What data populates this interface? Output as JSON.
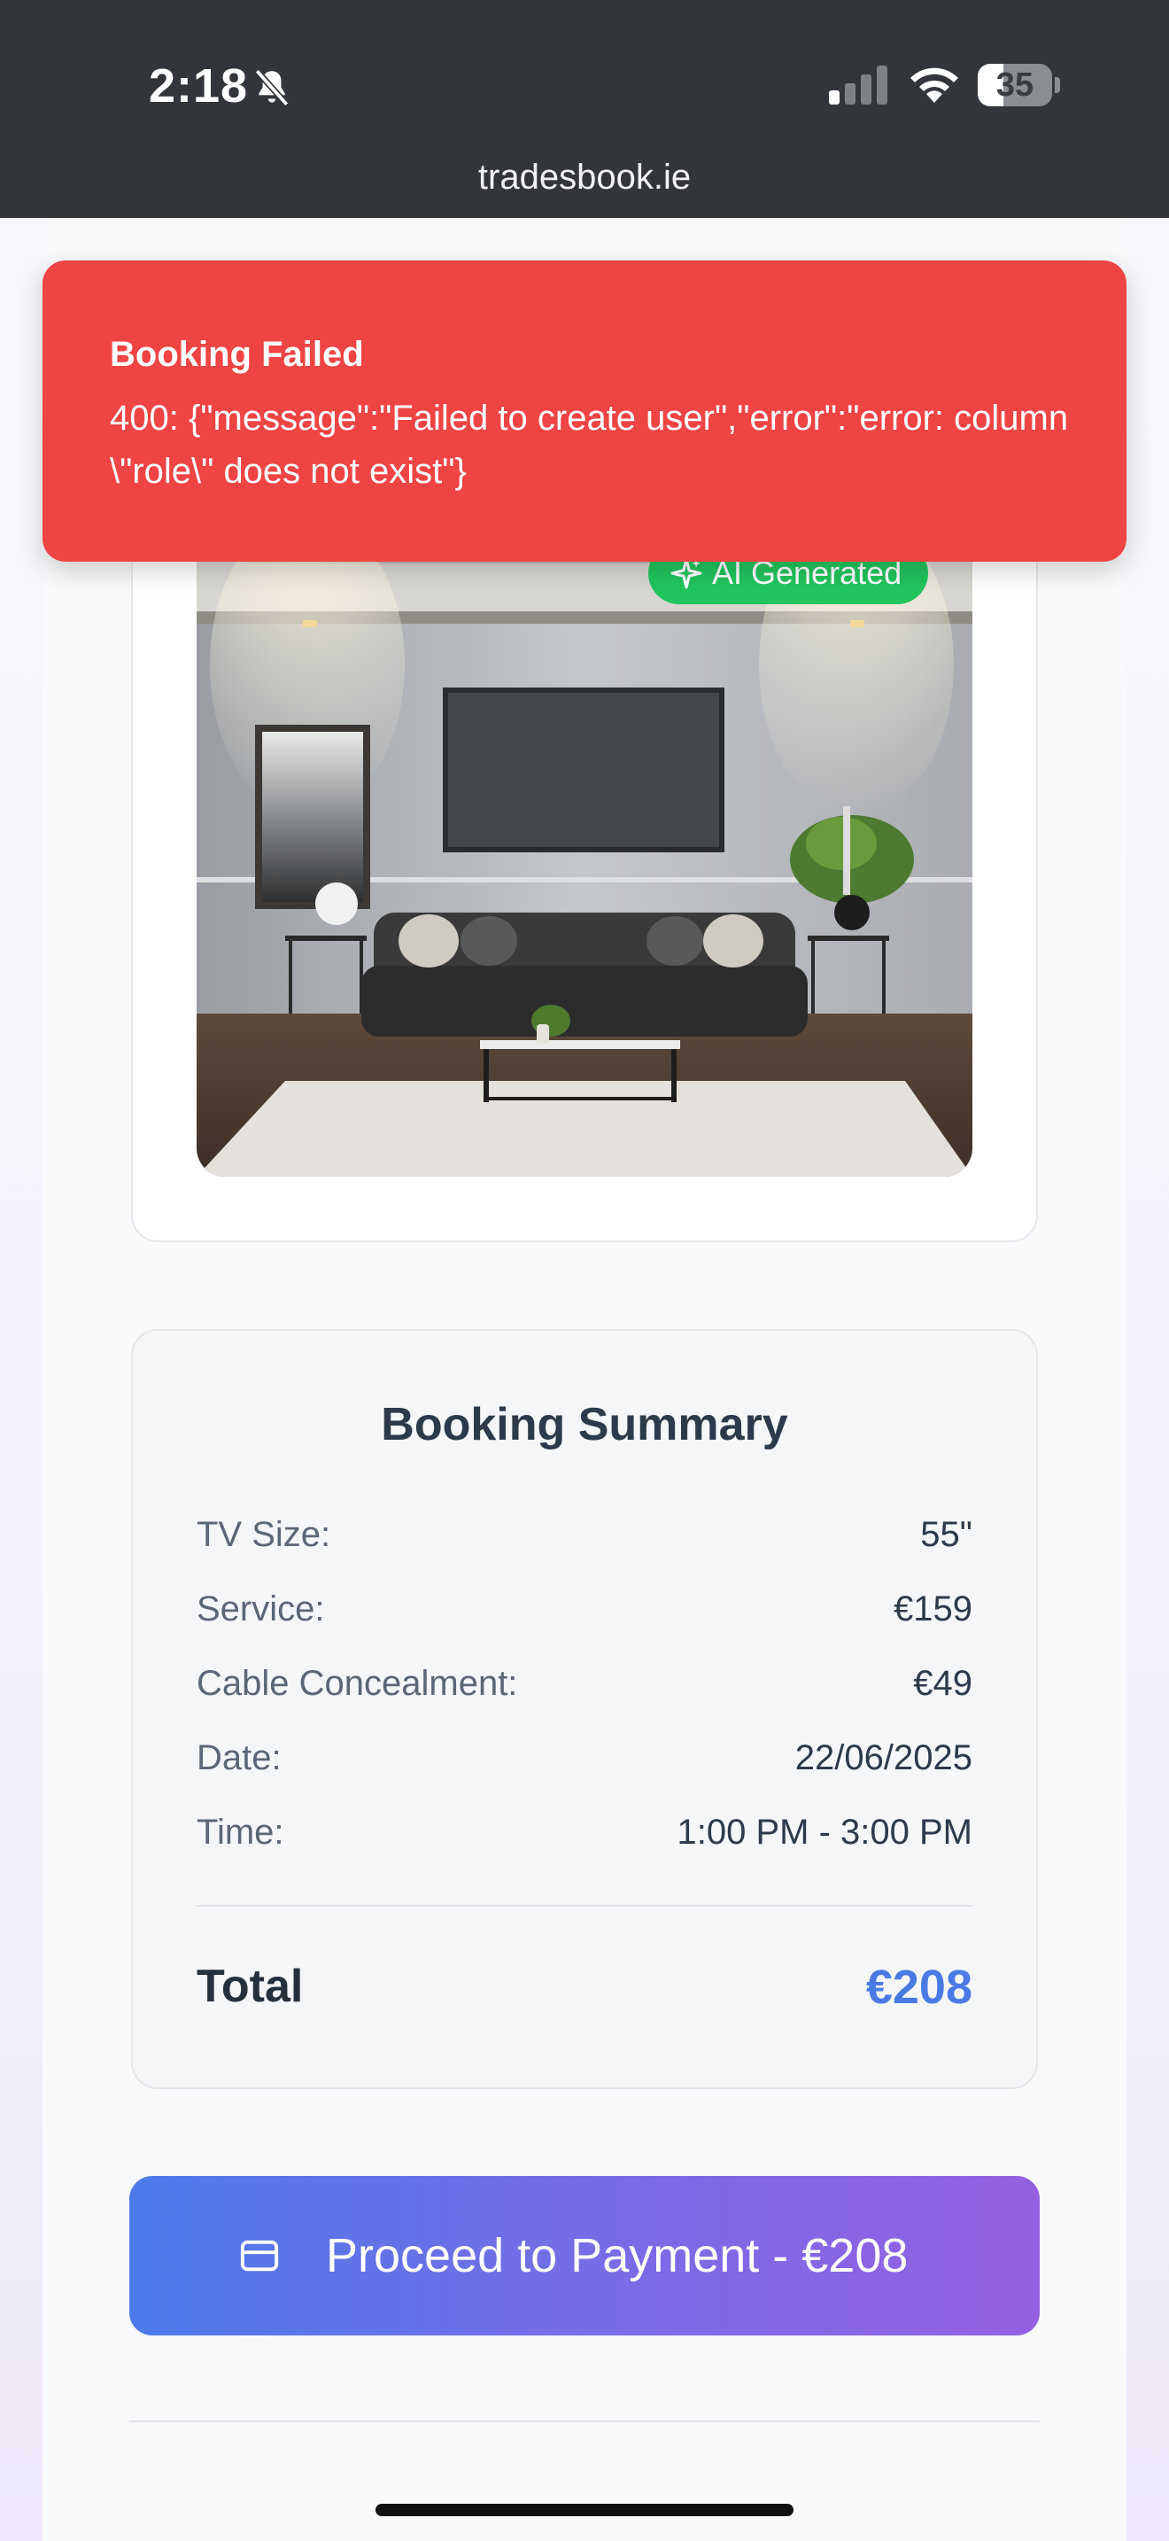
{
  "status_bar": {
    "time": "2:18",
    "battery_level": "35",
    "battery_fraction": 0.35,
    "icons": [
      "bell-slash-icon",
      "signal-icon",
      "wifi-icon",
      "battery-icon"
    ]
  },
  "browser": {
    "url": "tradesbook.ie"
  },
  "toast": {
    "title": "Booking Failed",
    "message": "400: {\"message\":\"Failed to create user\",\"error\":\"error: column \\\"role\\\" does not exist\"}",
    "color": "#ef4444"
  },
  "preview": {
    "badge_label": "AI Generated",
    "badge_icon": "sparkle-icon",
    "badge_color": "#22c55e"
  },
  "summary": {
    "title": "Booking Summary",
    "rows": [
      {
        "label": "TV Size:",
        "value": "55\""
      },
      {
        "label": "Service:",
        "value": "€159"
      },
      {
        "label": "Cable Concealment:",
        "value": "€49"
      },
      {
        "label": "Date:",
        "value": "22/06/2025"
      },
      {
        "label": "Time:",
        "value": "1:00 PM - 3:00 PM"
      }
    ],
    "total_label": "Total",
    "total_value": "€208",
    "accent_color": "#4a7be4"
  },
  "actions": {
    "pay_label": "Proceed to Payment - €208",
    "pay_icon": "credit-card-icon"
  }
}
